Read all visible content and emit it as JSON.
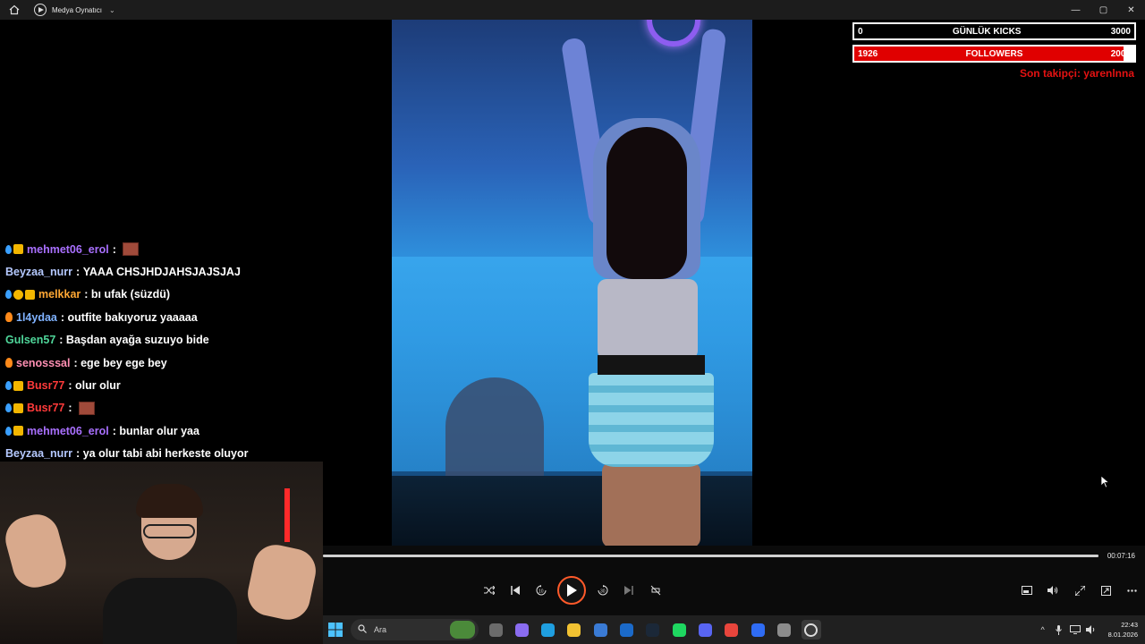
{
  "window": {
    "title": "Medya Oynatıcı",
    "controls": {
      "minimize": "—",
      "maximize": "▢",
      "close": "✕"
    }
  },
  "overlay": {
    "kicks": {
      "current": "0",
      "label": "GÜNLÜK KICKS",
      "goal": "3000",
      "progress": 0
    },
    "followers": {
      "current": "1926",
      "label": "FOLLOWERS",
      "goal": "2000",
      "progress": 0.963
    },
    "last_follower": "Son takipçi: yarenlnna"
  },
  "chat": {
    "messages": [
      {
        "badges": [
          "drop",
          "crown"
        ],
        "user": "mehmet06_erol",
        "color": "#a970ff",
        "text": "",
        "emote": true
      },
      {
        "badges": [],
        "user": "Beyzaa_nurr",
        "color": "#b5c9ff",
        "text": "YAAA CHSJHDJAHSJAJSJAJ",
        "emote": false
      },
      {
        "badges": [
          "drop",
          "num",
          "crown"
        ],
        "user": "melkkar",
        "color": "#ffa834",
        "text": "bı ufak (süzdü)",
        "emote": false
      },
      {
        "badges": [
          "fire"
        ],
        "user": "1l4ydaa",
        "color": "#7fb2ff",
        "text": "outfite bakıyoruz yaaaaa",
        "emote": false
      },
      {
        "badges": [],
        "user": "Gulsen57",
        "color": "#4fd69a",
        "text": "Başdan ayağa suzuyo bide",
        "emote": false
      },
      {
        "badges": [
          "fire"
        ],
        "user": "senosssal",
        "color": "#ff8fb3",
        "text": "ege bey ege bey",
        "emote": false
      },
      {
        "badges": [
          "drop",
          "crown"
        ],
        "user": "Busr77",
        "color": "#ff3a3a",
        "text": "olur olur",
        "emote": false
      },
      {
        "badges": [
          "drop",
          "crown"
        ],
        "user": "Busr77",
        "color": "#ff3a3a",
        "text": "",
        "emote": true
      },
      {
        "badges": [
          "drop",
          "crown"
        ],
        "user": "mehmet06_erol",
        "color": "#a970ff",
        "text": "bunlar olur yaa",
        "emote": false
      },
      {
        "badges": [],
        "user": "Beyzaa_nurr",
        "color": "#b5c9ff",
        "text": "ya olur tabi abi herkeste oluyor",
        "emote": false
      }
    ]
  },
  "player": {
    "elapsed": "00:07:16",
    "progress": 1.0,
    "controls": [
      "shuffle-icon",
      "previous-icon",
      "rewind-10-icon",
      "play-icon",
      "forward-30-icon",
      "next-icon",
      "repeat-off-icon"
    ],
    "right_controls": [
      "miniplayer-icon",
      "volume-icon",
      "fullscreen-icon",
      "cast-icon",
      "more-icon"
    ]
  },
  "taskbar": {
    "search_placeholder": "Ara",
    "apps": [
      "file-explorer-icon",
      "copilot-icon",
      "edge-icon",
      "folder-icon",
      "store-icon",
      "outlook-icon",
      "steam-icon",
      "spotify-icon",
      "discord-icon",
      "chrome-icon",
      "blue-app-icon",
      "settings-icon",
      "media-player-icon"
    ],
    "time": "22:43",
    "date": "8.01.2026",
    "accent": "#ff5a2a"
  }
}
